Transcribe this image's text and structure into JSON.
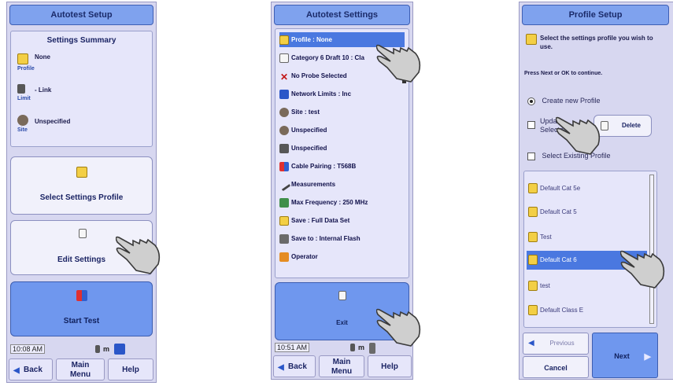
{
  "panel1": {
    "title": "Autotest Setup",
    "summary_title": "Settings Summary",
    "rows": [
      {
        "icon": "folder-icon",
        "key": "Profile",
        "value": "None"
      },
      {
        "icon": "limit-icon",
        "key": "Limit",
        "value": "- Link"
      },
      {
        "icon": "site-icon",
        "key": "Site",
        "value": "Unspecified"
      }
    ],
    "select_profile_label": "Select Settings Profile",
    "edit_settings_label": "Edit Settings",
    "start_test_label": "Start Test",
    "time": "10:08 AM",
    "length": "m",
    "menu": {
      "back": "Back",
      "main": "Main Menu",
      "help": "Help"
    }
  },
  "panel2": {
    "title": "Autotest Settings",
    "items": [
      {
        "icon": "folder-icon",
        "label": "Profile : None",
        "selected": true
      },
      {
        "icon": "doc-icon",
        "label": "Category 6 Draft 10 : Cla"
      },
      {
        "icon": "x-icon",
        "label": "No Probe Selected"
      },
      {
        "icon": "network-icon",
        "label": "Network Limits : Inc"
      },
      {
        "icon": "site-icon",
        "label": "Site : test"
      },
      {
        "icon": "gear-icon",
        "label": "Unspecified"
      },
      {
        "icon": "lock-icon",
        "label": "Unspecified"
      },
      {
        "icon": "cable-icon",
        "label": "Cable Pairing : T568B"
      },
      {
        "icon": "probe-icon",
        "label": "Measurements"
      },
      {
        "icon": "chart-icon",
        "label": "Max Frequency : 250 MHz"
      },
      {
        "icon": "folder-icon",
        "label": "Save : Full Data Set"
      },
      {
        "icon": "bin-icon",
        "label": "Save to : Internal Flash"
      },
      {
        "icon": "orange-icon",
        "label": "Operator"
      }
    ],
    "exit_label": "Exit",
    "time": "10:51 AM",
    "length": "m",
    "menu": {
      "back": "Back",
      "main": "Main Menu",
      "help": "Help"
    }
  },
  "panel3": {
    "title": "Profile Setup",
    "instruction": "Select the settings profile you wish to use.",
    "press_hint": "Press Next or OK to continue.",
    "options": [
      {
        "label": "Create new Profile",
        "type": "radio",
        "checked": true
      },
      {
        "label": "Update Selected",
        "type": "check",
        "checked": false
      },
      {
        "label": "Select Existing Profile",
        "type": "check",
        "checked": false
      }
    ],
    "delete_label": "Delete",
    "profiles": [
      {
        "label": "Default Cat 5e",
        "selected": false
      },
      {
        "label": "Default Cat 5",
        "selected": false
      },
      {
        "label": "Test",
        "selected": false
      },
      {
        "label": "Default Cat 6",
        "selected": true
      },
      {
        "label": "test",
        "selected": false
      },
      {
        "label": "Default Class E",
        "selected": false
      }
    ],
    "previous_label": "Previous",
    "cancel_label": "Cancel",
    "next_label": "Next"
  }
}
